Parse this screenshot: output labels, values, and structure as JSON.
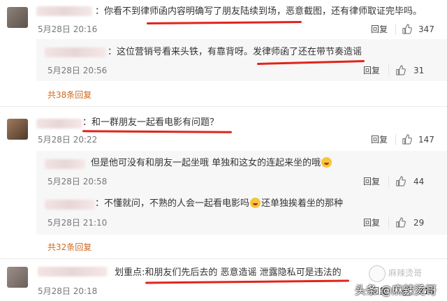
{
  "comments": [
    {
      "text": "：你看不到律师函内容明确写了朋友陆续到场，恶意截图，还有律师取证完毕吗。",
      "time": "5月28日 20:16",
      "reply": "回复",
      "likes": "347",
      "sub": [
        {
          "text": "：这位营销号看来头铁，有靠背呀。发律师函了还在带节奏造谣",
          "time": "5月28日 20:56",
          "reply": "回复",
          "likes": "31"
        }
      ],
      "more": "共38条回复"
    },
    {
      "text": "：和一群朋友一起看电影有问题？",
      "time": "5月28日 20:22",
      "reply": "回复",
      "likes": "147",
      "sub": [
        {
          "text": "但是他可没有和朋友一起坐哦 单独和这女的连起来坐的哦",
          "time": "5月28日 20:58",
          "reply": "回复",
          "likes": "44"
        },
        {
          "text_a": "：不懂就问，不熟的人会一起看电影吗",
          "text_b": "还单独挨着坐的那种",
          "time": "5月28日 21:10",
          "reply": "回复",
          "likes": "29"
        }
      ],
      "more": "共32条回复"
    },
    {
      "text": "划重点:和朋友们先后去的 恶意造谣 泄露隐私可是违法的",
      "time": "5月28日 20:18",
      "reply": "回复",
      "likes": "216"
    }
  ],
  "watermark": {
    "main": "头条 @麻辣烫哥",
    "secondary": "麻辣烫哥"
  },
  "colors": {
    "link": "#d2691e",
    "underline": "#e0241b",
    "subbox": "#f7f7f7"
  },
  "icons": [
    "thumbs-up-icon",
    "laughing-emoji-icon",
    "crying-laughing-emoji-icon"
  ]
}
